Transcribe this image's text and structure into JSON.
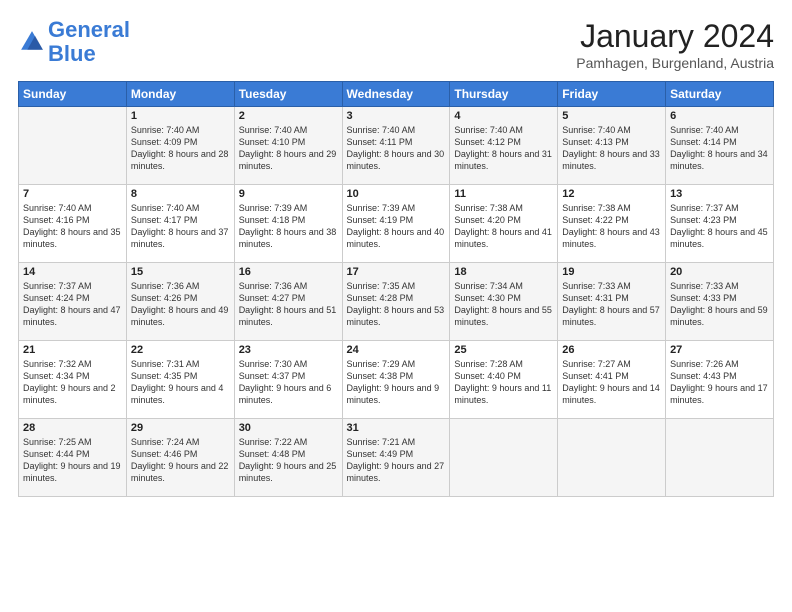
{
  "header": {
    "logo_line1": "General",
    "logo_line2": "Blue",
    "month": "January 2024",
    "location": "Pamhagen, Burgenland, Austria"
  },
  "weekdays": [
    "Sunday",
    "Monday",
    "Tuesday",
    "Wednesday",
    "Thursday",
    "Friday",
    "Saturday"
  ],
  "weeks": [
    [
      {
        "day": "",
        "sunrise": "",
        "sunset": "",
        "daylight": ""
      },
      {
        "day": "1",
        "sunrise": "Sunrise: 7:40 AM",
        "sunset": "Sunset: 4:09 PM",
        "daylight": "Daylight: 8 hours and 28 minutes."
      },
      {
        "day": "2",
        "sunrise": "Sunrise: 7:40 AM",
        "sunset": "Sunset: 4:10 PM",
        "daylight": "Daylight: 8 hours and 29 minutes."
      },
      {
        "day": "3",
        "sunrise": "Sunrise: 7:40 AM",
        "sunset": "Sunset: 4:11 PM",
        "daylight": "Daylight: 8 hours and 30 minutes."
      },
      {
        "day": "4",
        "sunrise": "Sunrise: 7:40 AM",
        "sunset": "Sunset: 4:12 PM",
        "daylight": "Daylight: 8 hours and 31 minutes."
      },
      {
        "day": "5",
        "sunrise": "Sunrise: 7:40 AM",
        "sunset": "Sunset: 4:13 PM",
        "daylight": "Daylight: 8 hours and 33 minutes."
      },
      {
        "day": "6",
        "sunrise": "Sunrise: 7:40 AM",
        "sunset": "Sunset: 4:14 PM",
        "daylight": "Daylight: 8 hours and 34 minutes."
      }
    ],
    [
      {
        "day": "7",
        "sunrise": "Sunrise: 7:40 AM",
        "sunset": "Sunset: 4:16 PM",
        "daylight": "Daylight: 8 hours and 35 minutes."
      },
      {
        "day": "8",
        "sunrise": "Sunrise: 7:40 AM",
        "sunset": "Sunset: 4:17 PM",
        "daylight": "Daylight: 8 hours and 37 minutes."
      },
      {
        "day": "9",
        "sunrise": "Sunrise: 7:39 AM",
        "sunset": "Sunset: 4:18 PM",
        "daylight": "Daylight: 8 hours and 38 minutes."
      },
      {
        "day": "10",
        "sunrise": "Sunrise: 7:39 AM",
        "sunset": "Sunset: 4:19 PM",
        "daylight": "Daylight: 8 hours and 40 minutes."
      },
      {
        "day": "11",
        "sunrise": "Sunrise: 7:38 AM",
        "sunset": "Sunset: 4:20 PM",
        "daylight": "Daylight: 8 hours and 41 minutes."
      },
      {
        "day": "12",
        "sunrise": "Sunrise: 7:38 AM",
        "sunset": "Sunset: 4:22 PM",
        "daylight": "Daylight: 8 hours and 43 minutes."
      },
      {
        "day": "13",
        "sunrise": "Sunrise: 7:37 AM",
        "sunset": "Sunset: 4:23 PM",
        "daylight": "Daylight: 8 hours and 45 minutes."
      }
    ],
    [
      {
        "day": "14",
        "sunrise": "Sunrise: 7:37 AM",
        "sunset": "Sunset: 4:24 PM",
        "daylight": "Daylight: 8 hours and 47 minutes."
      },
      {
        "day": "15",
        "sunrise": "Sunrise: 7:36 AM",
        "sunset": "Sunset: 4:26 PM",
        "daylight": "Daylight: 8 hours and 49 minutes."
      },
      {
        "day": "16",
        "sunrise": "Sunrise: 7:36 AM",
        "sunset": "Sunset: 4:27 PM",
        "daylight": "Daylight: 8 hours and 51 minutes."
      },
      {
        "day": "17",
        "sunrise": "Sunrise: 7:35 AM",
        "sunset": "Sunset: 4:28 PM",
        "daylight": "Daylight: 8 hours and 53 minutes."
      },
      {
        "day": "18",
        "sunrise": "Sunrise: 7:34 AM",
        "sunset": "Sunset: 4:30 PM",
        "daylight": "Daylight: 8 hours and 55 minutes."
      },
      {
        "day": "19",
        "sunrise": "Sunrise: 7:33 AM",
        "sunset": "Sunset: 4:31 PM",
        "daylight": "Daylight: 8 hours and 57 minutes."
      },
      {
        "day": "20",
        "sunrise": "Sunrise: 7:33 AM",
        "sunset": "Sunset: 4:33 PM",
        "daylight": "Daylight: 8 hours and 59 minutes."
      }
    ],
    [
      {
        "day": "21",
        "sunrise": "Sunrise: 7:32 AM",
        "sunset": "Sunset: 4:34 PM",
        "daylight": "Daylight: 9 hours and 2 minutes."
      },
      {
        "day": "22",
        "sunrise": "Sunrise: 7:31 AM",
        "sunset": "Sunset: 4:35 PM",
        "daylight": "Daylight: 9 hours and 4 minutes."
      },
      {
        "day": "23",
        "sunrise": "Sunrise: 7:30 AM",
        "sunset": "Sunset: 4:37 PM",
        "daylight": "Daylight: 9 hours and 6 minutes."
      },
      {
        "day": "24",
        "sunrise": "Sunrise: 7:29 AM",
        "sunset": "Sunset: 4:38 PM",
        "daylight": "Daylight: 9 hours and 9 minutes."
      },
      {
        "day": "25",
        "sunrise": "Sunrise: 7:28 AM",
        "sunset": "Sunset: 4:40 PM",
        "daylight": "Daylight: 9 hours and 11 minutes."
      },
      {
        "day": "26",
        "sunrise": "Sunrise: 7:27 AM",
        "sunset": "Sunset: 4:41 PM",
        "daylight": "Daylight: 9 hours and 14 minutes."
      },
      {
        "day": "27",
        "sunrise": "Sunrise: 7:26 AM",
        "sunset": "Sunset: 4:43 PM",
        "daylight": "Daylight: 9 hours and 17 minutes."
      }
    ],
    [
      {
        "day": "28",
        "sunrise": "Sunrise: 7:25 AM",
        "sunset": "Sunset: 4:44 PM",
        "daylight": "Daylight: 9 hours and 19 minutes."
      },
      {
        "day": "29",
        "sunrise": "Sunrise: 7:24 AM",
        "sunset": "Sunset: 4:46 PM",
        "daylight": "Daylight: 9 hours and 22 minutes."
      },
      {
        "day": "30",
        "sunrise": "Sunrise: 7:22 AM",
        "sunset": "Sunset: 4:48 PM",
        "daylight": "Daylight: 9 hours and 25 minutes."
      },
      {
        "day": "31",
        "sunrise": "Sunrise: 7:21 AM",
        "sunset": "Sunset: 4:49 PM",
        "daylight": "Daylight: 9 hours and 27 minutes."
      },
      {
        "day": "",
        "sunrise": "",
        "sunset": "",
        "daylight": ""
      },
      {
        "day": "",
        "sunrise": "",
        "sunset": "",
        "daylight": ""
      },
      {
        "day": "",
        "sunrise": "",
        "sunset": "",
        "daylight": ""
      }
    ]
  ]
}
